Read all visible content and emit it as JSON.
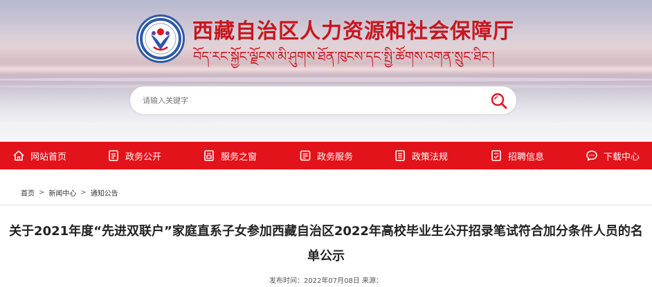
{
  "header": {
    "title_zh": "西藏自治区人力资源和社会保障厅",
    "title_bo": "བོད་རང་སྐྱོང་ལྗོངས་མི་ཤུགས་ཐོན་ཁུངས་དང་སྤྱི་ཚོགས་འགན་སྲུང་ཐིང་།",
    "search_placeholder": "请输入关键字"
  },
  "nav": {
    "items": [
      {
        "label": "网站首页",
        "icon": "home-icon"
      },
      {
        "label": "政务公开",
        "icon": "document-icon"
      },
      {
        "label": "服务之窗",
        "icon": "service-window-icon"
      },
      {
        "label": "政务服务",
        "icon": "affairs-icon"
      },
      {
        "label": "政策法规",
        "icon": "policy-icon"
      },
      {
        "label": "招聘信息",
        "icon": "recruit-icon"
      },
      {
        "label": "下载中心",
        "icon": "download-chat-icon"
      }
    ]
  },
  "breadcrumb": {
    "items": [
      "首页",
      "新闻中心",
      "通知公告"
    ],
    "separator": ">"
  },
  "article": {
    "title": "关于2021年度“先进双联户”家庭直系子女参加西藏自治区2022年高校毕业生公开招录笔试符合加分条件人员的名单公示",
    "meta": "发布时间：2022年07月08日 来源："
  },
  "colors": {
    "brand_red": "#e3131b",
    "title_red": "#c8161d",
    "logo_blue": "#2d59a8"
  }
}
